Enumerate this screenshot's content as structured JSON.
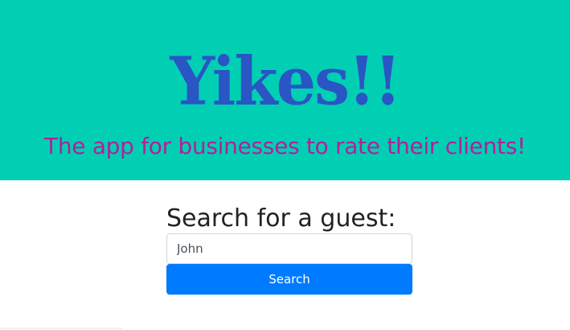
{
  "header": {
    "logo_text": "Yikes!!",
    "tagline": "The app for businesses to rate their clients!",
    "background_color": "#00cfb4",
    "logo_color": "#2a55c4",
    "tagline_color": "#b0219a"
  },
  "search": {
    "heading": "Search for a guest:",
    "input_value": "John",
    "button_label": "Search",
    "button_color": "#007bff"
  }
}
